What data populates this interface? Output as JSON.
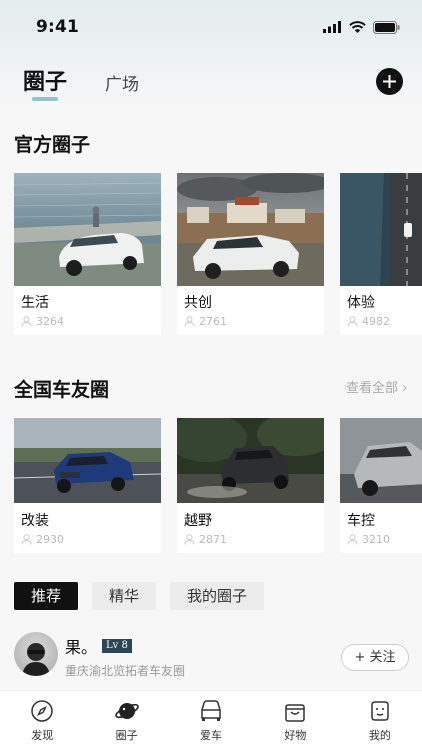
{
  "status_bar": {
    "time": "9:41"
  },
  "header": {
    "tabs": [
      {
        "label": "圈子"
      },
      {
        "label": "广场"
      }
    ]
  },
  "official_section": {
    "title": "官方圈子",
    "cards": [
      {
        "name": "生活",
        "count": "3264"
      },
      {
        "name": "共创",
        "count": "2761"
      },
      {
        "name": "体验",
        "count": "4982"
      }
    ]
  },
  "national_section": {
    "title": "全国车友圈",
    "see_all": "查看全部 ›",
    "cards": [
      {
        "name": "改装",
        "count": "2930"
      },
      {
        "name": "越野",
        "count": "2871"
      },
      {
        "name": "车控",
        "count": "3210"
      }
    ]
  },
  "filters": [
    {
      "label": "推荐",
      "active": true
    },
    {
      "label": "精华",
      "active": false
    },
    {
      "label": "我的圈子",
      "active": false
    }
  ],
  "post": {
    "author": "果。",
    "level": "Lv 8",
    "circle": "重庆渝北览拓者车友圈",
    "follow": "+ 关注"
  },
  "bottom_nav": [
    {
      "label": "发现",
      "icon": "compass-icon"
    },
    {
      "label": "圈子",
      "icon": "planet-icon"
    },
    {
      "label": "爱车",
      "icon": "car-icon"
    },
    {
      "label": "好物",
      "icon": "shopping-bag-icon"
    },
    {
      "label": "我的",
      "icon": "profile-icon"
    }
  ],
  "colors": {
    "accent": "#8fc3cf",
    "dark": "#111111",
    "badge": "#2d4656"
  }
}
